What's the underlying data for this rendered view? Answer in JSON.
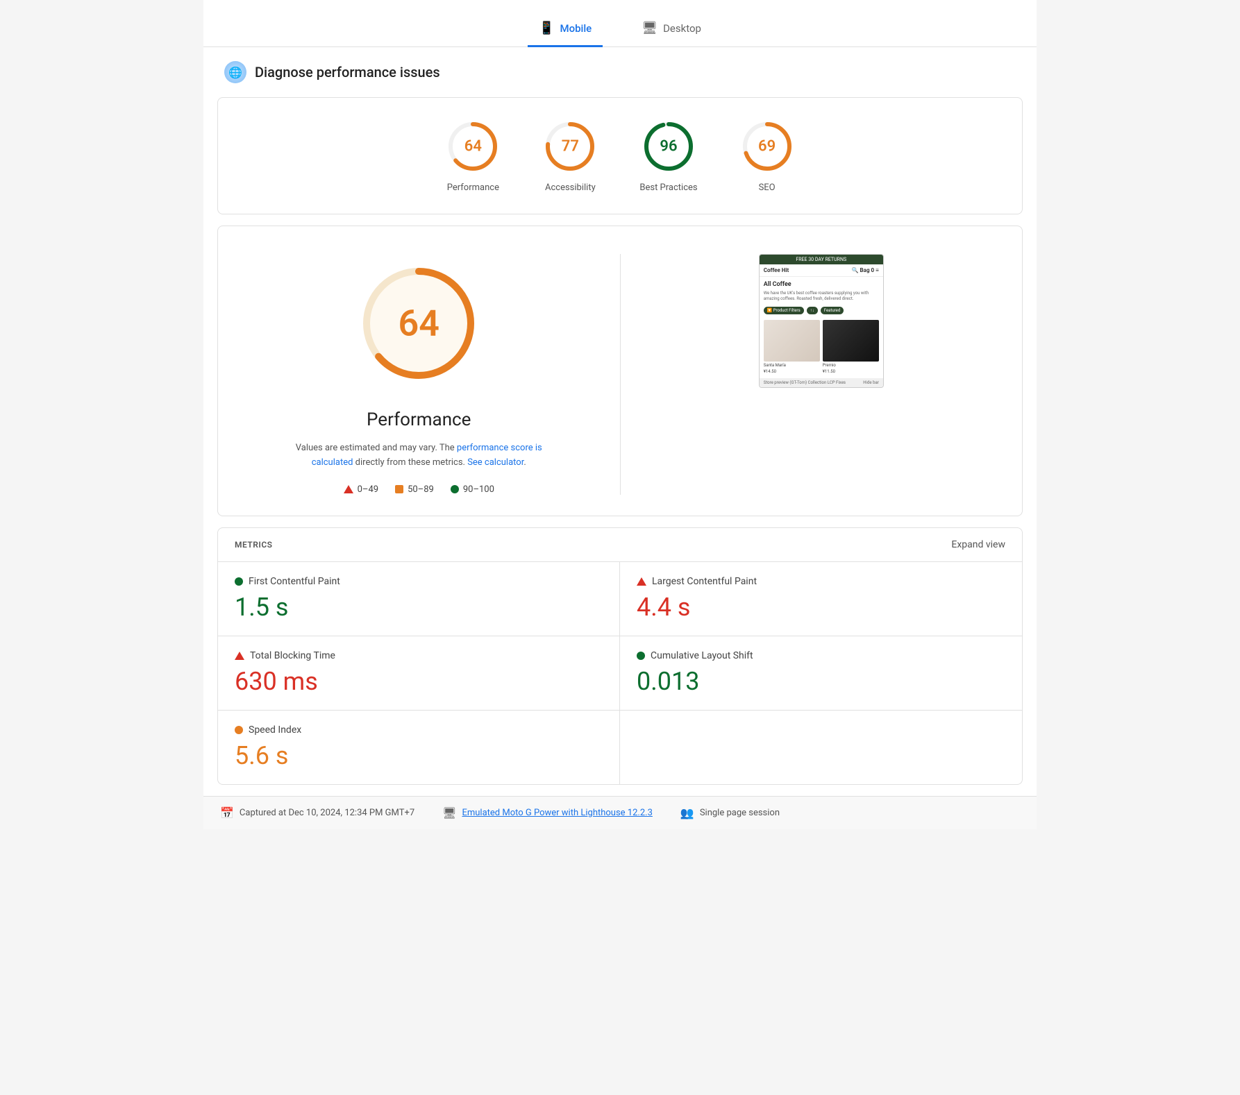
{
  "tabs": [
    {
      "id": "mobile",
      "label": "Mobile",
      "active": true,
      "icon": "📱"
    },
    {
      "id": "desktop",
      "label": "Desktop",
      "active": false,
      "icon": "🖥"
    }
  ],
  "header": {
    "title": "Diagnose performance issues",
    "icon_label": "globe"
  },
  "score_cards": [
    {
      "id": "performance",
      "value": "64",
      "label": "Performance",
      "color": "#e67e22",
      "stroke_color": "#e67e22",
      "bg_color": "#fff3e0",
      "percent": 64
    },
    {
      "id": "accessibility",
      "value": "77",
      "label": "Accessibility",
      "color": "#e67e22",
      "stroke_color": "#e67e22",
      "bg_color": "#fff3e0",
      "percent": 77
    },
    {
      "id": "best_practices",
      "value": "96",
      "label": "Best Practices",
      "color": "#0c6e2f",
      "stroke_color": "#0c6e2f",
      "bg_color": "#e8f5e9",
      "percent": 96
    },
    {
      "id": "seo",
      "value": "69",
      "label": "SEO",
      "color": "#e67e22",
      "stroke_color": "#e67e22",
      "bg_color": "#fff3e0",
      "percent": 69
    }
  ],
  "big_score": {
    "value": "64",
    "label": "Performance",
    "description_text": "Values are estimated and may vary. The ",
    "link_text": "performance score is calculated",
    "middle_text": " directly from these metrics. ",
    "link2_text": "See calculator",
    "period": "."
  },
  "legend": [
    {
      "id": "poor",
      "range": "0–49",
      "type": "triangle",
      "color": "#d93025"
    },
    {
      "id": "needs-improvement",
      "range": "50–89",
      "type": "square",
      "color": "#e67e22"
    },
    {
      "id": "good",
      "range": "90–100",
      "type": "dot",
      "color": "#0c6e2f"
    }
  ],
  "screenshot": {
    "top_bar": "FREE 30 DAY RETURNS",
    "site_name": "Coffee Hit",
    "heading": "All Coffee",
    "body_text": "We have the UK's best coffee roasters supplying you with amazing coffees. Roasted fresh, delivered direct.",
    "btn1": "🔽 Product Filters",
    "btn2": "↑↓",
    "btn3": "Featured",
    "product1_name": "Santa María",
    "product1_price": "¥14.50",
    "product2_name": "Premio",
    "product2_price": "¥11.50",
    "bottom_text": "Store preview (GT-Tom) Collection LCP Fixes",
    "hide_bar": "Hide bar"
  },
  "metrics_section": {
    "title": "METRICS",
    "expand_label": "Expand view",
    "items": [
      {
        "id": "first-contentful-paint",
        "name": "First Contentful Paint",
        "value": "1.5 s",
        "indicator": "green",
        "value_color": "green"
      },
      {
        "id": "largest-contentful-paint",
        "name": "Largest Contentful Paint",
        "value": "4.4 s",
        "indicator": "triangle",
        "value_color": "red"
      },
      {
        "id": "total-blocking-time",
        "name": "Total Blocking Time",
        "value": "630 ms",
        "indicator": "triangle",
        "value_color": "red"
      },
      {
        "id": "cumulative-layout-shift",
        "name": "Cumulative Layout Shift",
        "value": "0.013",
        "indicator": "green",
        "value_color": "green"
      },
      {
        "id": "speed-index",
        "name": "Speed Index",
        "value": "5.6 s",
        "indicator": "orange",
        "value_color": "orange"
      }
    ]
  },
  "footer": {
    "captured_label": "Captured at Dec 10, 2024, 12:34 PM GMT+7",
    "device_label": "Emulated Moto G Power with Lighthouse 12.2.3",
    "session_label": "Single page session"
  }
}
